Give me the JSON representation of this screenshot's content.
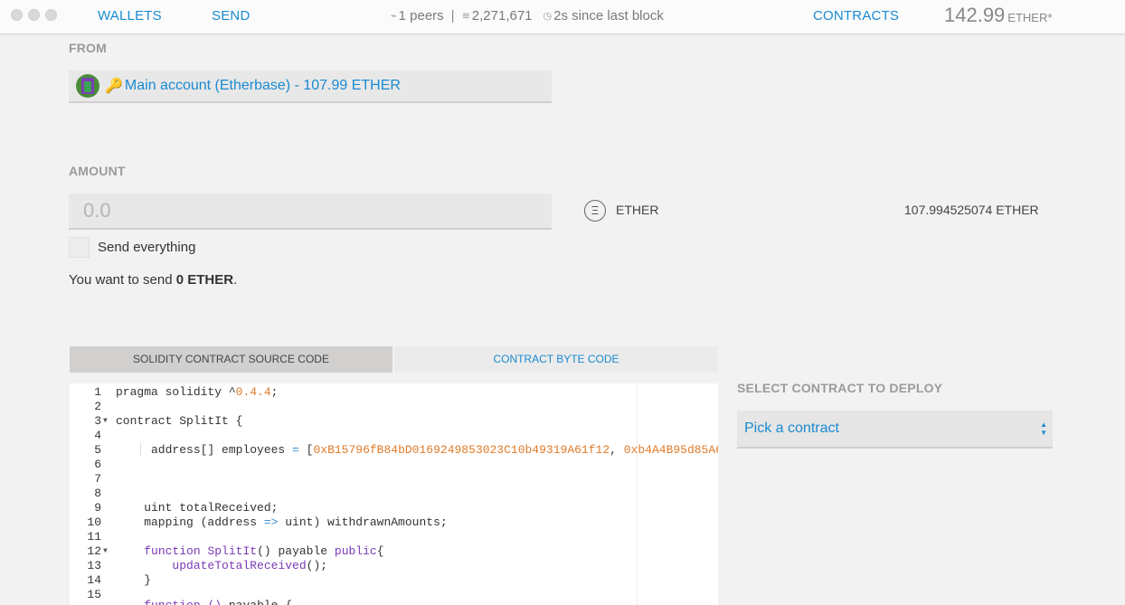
{
  "topbar": {
    "nav_wallets": "WALLETS",
    "nav_send": "SEND",
    "peers": "1 peers",
    "block_number": "2,271,671",
    "last_block": "2s since last block",
    "nav_contracts": "CONTRACTS",
    "balance_value": "142.99",
    "balance_unit": "ETHER*"
  },
  "from": {
    "label": "FROM",
    "account": "Main account (Etherbase) - 107.99 ETHER"
  },
  "amount": {
    "label": "AMOUNT",
    "placeholder": "0.0",
    "currency_symbol": "Ξ",
    "currency": "ETHER",
    "available_balance": "107.994525074 ETHER",
    "send_everything_label": "Send everything",
    "summary_prefix": "You want to send ",
    "summary_amount": "0 ETHER",
    "summary_suffix": "."
  },
  "tabs": {
    "source": "SOLIDITY CONTRACT SOURCE CODE",
    "bytecode": "CONTRACT BYTE CODE"
  },
  "deploy": {
    "label": "SELECT CONTRACT TO DEPLOY",
    "select_value": "Pick a contract"
  },
  "code": {
    "line_numbers": [
      "1",
      "2",
      "3",
      "4",
      "5",
      "6",
      "7",
      "8",
      "9",
      "10",
      "11",
      "12",
      "13",
      "14",
      "15"
    ],
    "folded_lines": [
      "3",
      "12"
    ]
  }
}
